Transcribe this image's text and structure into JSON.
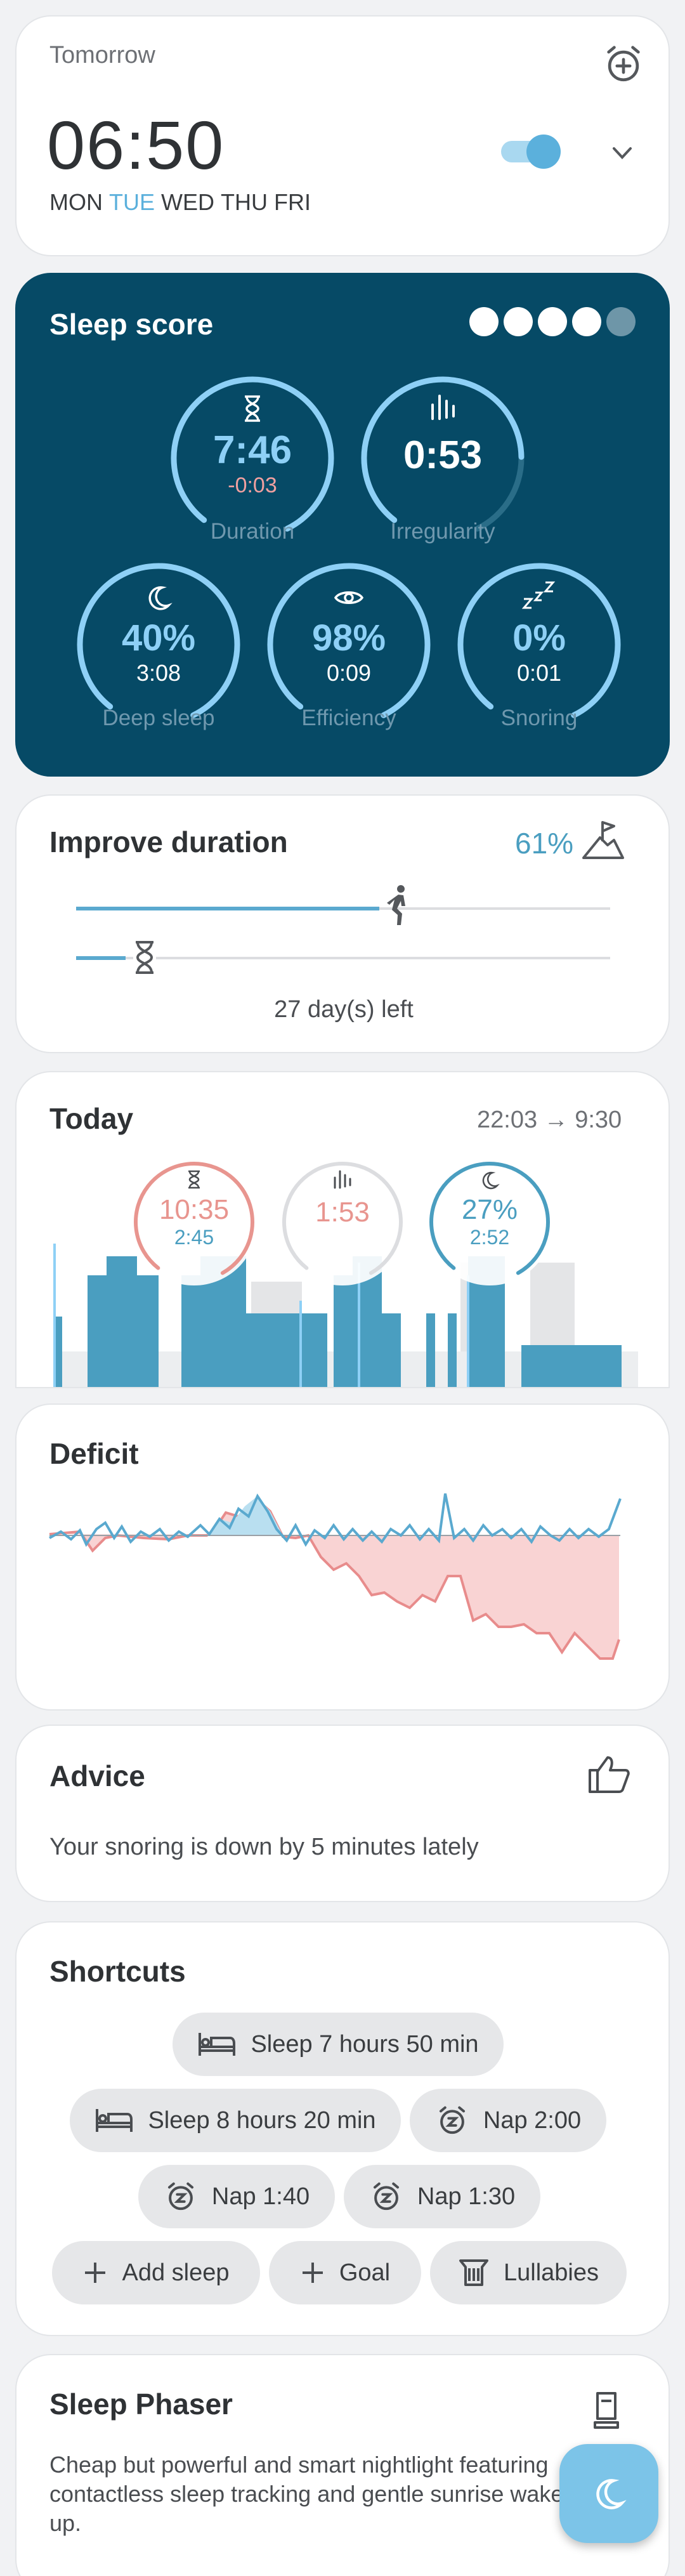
{
  "alarm": {
    "label": "Tomorrow",
    "time": "06:50",
    "days": [
      "MON",
      "TUE",
      "WED",
      "THU",
      "FRI"
    ],
    "active_day_index": 1,
    "enabled": true,
    "accent_color": "#5bb0dc"
  },
  "sleep_score": {
    "title": "Sleep score",
    "score_dots_filled": 4,
    "score_dots_total": 5,
    "duration": {
      "value": "7:46",
      "delta": "-0:03",
      "label": "Duration",
      "icon": "hourglass-icon",
      "level": 0.9
    },
    "irregularity": {
      "value": "0:53",
      "label": "Irregularity",
      "icon": "equalizer-icon",
      "level": 0.78
    },
    "deep_sleep": {
      "value": "40%",
      "sub": "3:08",
      "label": "Deep sleep",
      "icon": "moon-icon",
      "level": 0.9
    },
    "efficiency": {
      "value": "98%",
      "sub": "0:09",
      "label": "Efficiency",
      "icon": "eye-icon",
      "level": 0.9
    },
    "snoring": {
      "value": "0%",
      "sub": "0:01",
      "label": "Snoring",
      "icon": "zzz-icon",
      "level": 0.9
    },
    "background_color": "#064a66",
    "ring_color": "#8ed0f6",
    "delta_color": "#f0a0a0"
  },
  "improve": {
    "title": "Improve duration",
    "percent": "61%",
    "progress": 0.61,
    "days_left": "27 day(s) left",
    "icon": "summit-flag-icon"
  },
  "today": {
    "title": "Today",
    "time_range": "22:03 → 9:30",
    "duration": {
      "value": "10:35",
      "sub": "2:45",
      "icon": "hourglass-icon",
      "color": "#e8958f"
    },
    "irregularity": {
      "value": "1:53",
      "icon": "equalizer-icon",
      "color": "#e8958f"
    },
    "deep": {
      "value": "27%",
      "sub": "2:52",
      "icon": "moon-icon",
      "color": "#4a9ec0"
    }
  },
  "deficit": {
    "title": "Deficit",
    "line_color": "#5aa9cf",
    "deficit_fill": "#f9d3d3",
    "deficit_line": "#e88c8c"
  },
  "advice": {
    "title": "Advice",
    "text": "Your snoring is down by 5 minutes lately",
    "icon": "thumbs-up-icon"
  },
  "shortcuts": {
    "title": "Shortcuts",
    "items": [
      {
        "label": "Sleep 7 hours 50 min",
        "icon": "bed-icon"
      },
      {
        "label": "Sleep 8 hours 20 min",
        "icon": "bed-icon"
      },
      {
        "label": "Nap 2:00",
        "icon": "alarm-clock-icon"
      },
      {
        "label": "Nap 1:40",
        "icon": "alarm-clock-icon"
      },
      {
        "label": "Nap 1:30",
        "icon": "alarm-clock-icon"
      },
      {
        "label": "Add sleep",
        "icon": "plus-icon"
      },
      {
        "label": "Goal",
        "icon": "plus-icon"
      },
      {
        "label": "Lullabies",
        "icon": "harp-icon"
      }
    ]
  },
  "phaser": {
    "title": "Sleep Phaser",
    "text": "Cheap but powerful and smart nightlight featuring contactless sleep tracking and gentle sunrise wake up.",
    "icon": "lamp-icon"
  },
  "fab": {
    "icon": "moon-icon",
    "color": "#7cc4e8"
  }
}
